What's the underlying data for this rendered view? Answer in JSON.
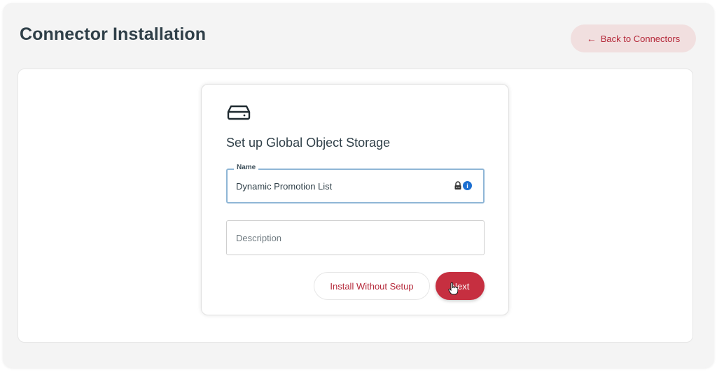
{
  "header": {
    "title": "Connector Installation",
    "back_button_label": "Back to Connectors",
    "back_icon": "arrow-left-icon"
  },
  "card": {
    "icon": "storage-drive-icon",
    "title": "Set up Global Object Storage",
    "name_field": {
      "label": "Name",
      "value": "Dynamic Promotion List",
      "icons": [
        "password-manager-icon",
        "info-icon"
      ],
      "info_glyph": "i"
    },
    "description_field": {
      "placeholder": "Description",
      "value": ""
    },
    "actions": {
      "secondary_label": "Install Without Setup",
      "primary_label": "Next"
    }
  },
  "colors": {
    "accent": "#c62f40",
    "accent_text": "#b5293a",
    "accent_soft": "#f1dfdf",
    "focus_border": "#8fb6d6",
    "title_text": "#2f3f48"
  }
}
